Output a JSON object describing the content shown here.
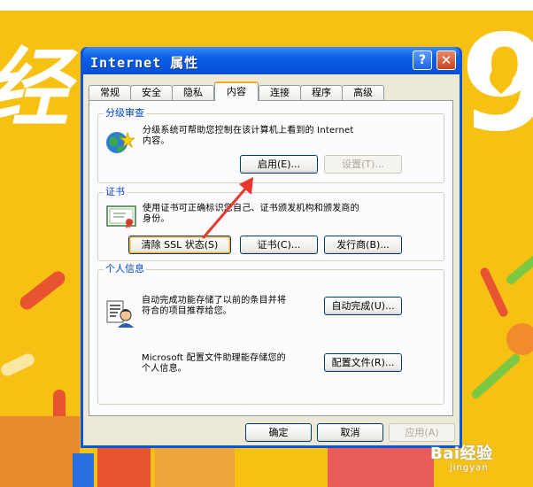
{
  "window": {
    "title": "Internet 属性",
    "help_label": "?",
    "close_label": "✕"
  },
  "tabs": [
    {
      "label": "常规"
    },
    {
      "label": "安全"
    },
    {
      "label": "隐私"
    },
    {
      "label": "内容",
      "active": true
    },
    {
      "label": "连接"
    },
    {
      "label": "程序"
    },
    {
      "label": "高级"
    }
  ],
  "rating": {
    "legend": "分级审查",
    "description_line1": "分级系统可帮助您控制在该计算机上看到的 Internet",
    "description_line2": "内容。",
    "enable_label": "启用(E)...",
    "settings_label": "设置(T)...",
    "icon": "globe-star-icon"
  },
  "certificates": {
    "legend": "证书",
    "description_line1": "使用证书可正确标识您自己、证书颁发机构和颁发商的",
    "description_line2": "身份。",
    "clear_ssl_label": "清除 SSL 状态(S)",
    "certificates_label": "证书(C)...",
    "publishers_label": "发行商(B)...",
    "icon": "certificate-icon"
  },
  "personal": {
    "legend": "个人信息",
    "autocomplete_line1": "自动完成功能存储了以前的条目并将",
    "autocomplete_line2": "符合的项目推荐给您。",
    "autocomplete_label": "自动完成(U)...",
    "profile_line1": "Microsoft 配置文件助理能存储您的",
    "profile_line2": "个人信息。",
    "profile_label": "配置文件(R)...",
    "icon": "personal-info-icon"
  },
  "footer": {
    "ok_label": "确定",
    "cancel_label": "取消",
    "apply_label": "应用(A)"
  },
  "watermark": {
    "text": "Bai经验",
    "sub": "jingyan"
  },
  "colors": {
    "title_bar": "#0a5fe6",
    "dialog_bg": "#ece9d8",
    "group_legend": "#0046d5",
    "annotation_arrow": "#e8372c",
    "background": "#f7c114"
  }
}
